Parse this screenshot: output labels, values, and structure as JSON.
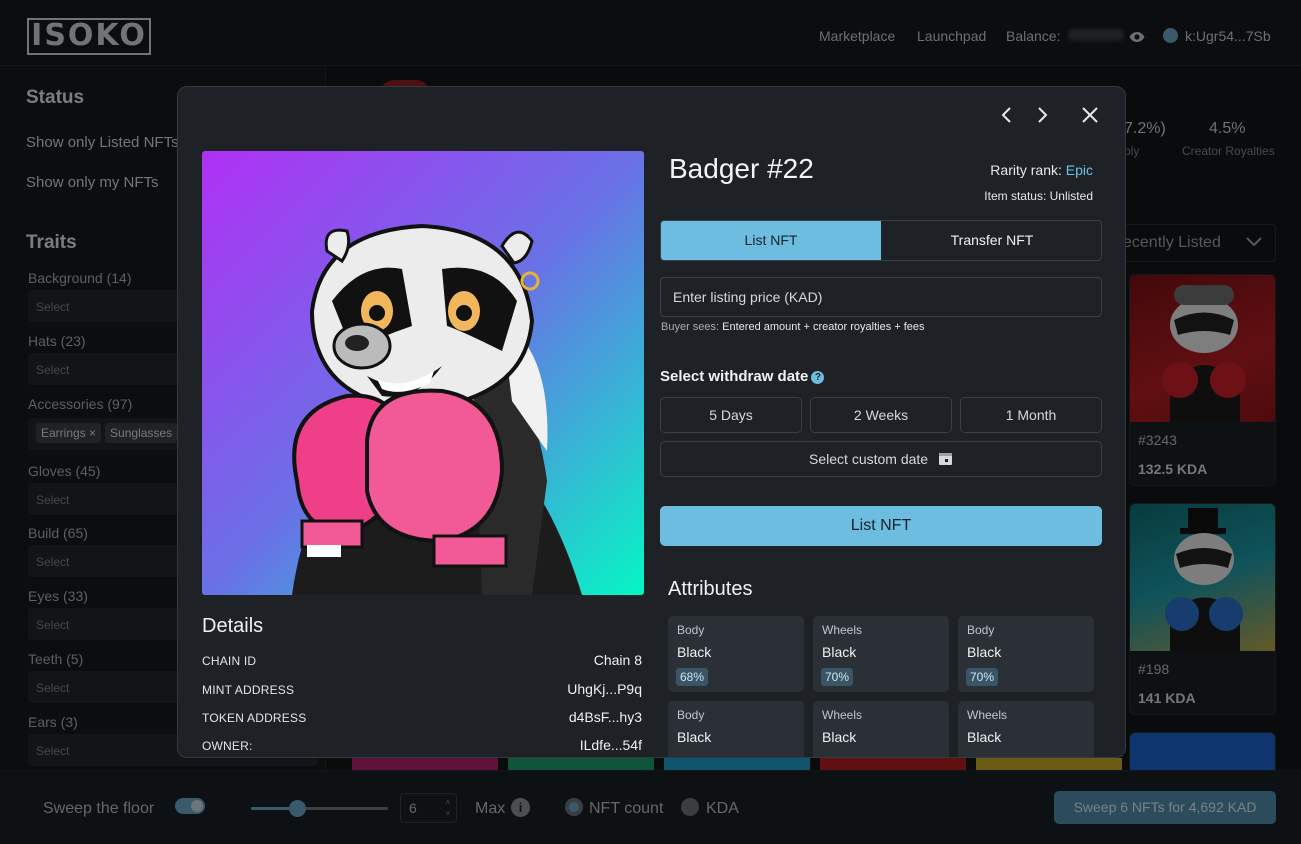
{
  "header": {
    "logo": "ISOKO",
    "nav": [
      "Marketplace",
      "Launchpad"
    ],
    "balance_label": "Balance:",
    "wallet": "k:Ugr54...7Sb"
  },
  "sidebar": {
    "status_title": "Status",
    "status_options": [
      "Show only Listed NFTs",
      "Show only my NFTs"
    ],
    "traits_title": "Traits",
    "traits": [
      {
        "label": "Background (14)",
        "placeholder": "Select"
      },
      {
        "label": "Hats (23)",
        "placeholder": "Select"
      },
      {
        "label": "Accessories (97)",
        "chips": [
          "Earrings",
          "Sunglasses"
        ]
      },
      {
        "label": "Gloves (45)",
        "placeholder": "Select"
      },
      {
        "label": "Build (65)",
        "placeholder": "Select"
      },
      {
        "label": "Eyes (33)",
        "placeholder": "Select"
      },
      {
        "label": "Teeth (5)",
        "placeholder": "Select"
      },
      {
        "label": "Ears (3)",
        "placeholder": "Select"
      }
    ]
  },
  "stats": {
    "supply_value": "7.2%)",
    "supply_label": "ply",
    "royalties_value": "4.5%",
    "royalties_label": "Creator Royalties"
  },
  "sort": {
    "label": "ecently Listed"
  },
  "cards": [
    {
      "id": "#3243",
      "price": "132.5 KDA"
    },
    {
      "id": "#198",
      "price": "141 KDA"
    }
  ],
  "bottom": {
    "sweep_label": "Sweep the floor",
    "count_value": "6",
    "max_label": "Max",
    "radio_count": "NFT count",
    "radio_kda": "KDA",
    "sweep_button": "Sweep 6 NFTs for 4,692 KAD"
  },
  "modal": {
    "title": "Badger #22",
    "rarity_label": "Rarity rank:",
    "rarity_value": "Epic",
    "status_text": "Item status: Unlisted",
    "tab_list": "List NFT",
    "tab_transfer": "Transfer NFT",
    "price_placeholder": "Enter listing price (KAD)",
    "buyer_label": "Buyer sees:",
    "buyer_text": "Entered amount + creator royalties + fees",
    "withdraw_title": "Select withdraw date",
    "date_options": [
      "5 Days",
      "2 Weeks",
      "1 Month"
    ],
    "custom_date": "Select custom date",
    "list_button": "List NFT",
    "details_title": "Details",
    "details": [
      {
        "label": "CHAIN ID",
        "value": "Chain 8"
      },
      {
        "label": "MINT ADDRESS",
        "value": "UhgKj...P9q"
      },
      {
        "label": "TOKEN ADDRESS",
        "value": "d4BsF...hy3"
      },
      {
        "label": "OWNER:",
        "value": "ILdfe...54f"
      }
    ],
    "attributes_title": "Attributes",
    "attributes": [
      {
        "type": "Body",
        "value": "Black",
        "pct": "68%"
      },
      {
        "type": "Wheels",
        "value": "Black",
        "pct": "70%"
      },
      {
        "type": "Body",
        "value": "Black",
        "pct": "70%"
      },
      {
        "type": "Body",
        "value": "Black",
        "pct": ""
      },
      {
        "type": "Wheels",
        "value": "Black",
        "pct": ""
      },
      {
        "type": "Wheels",
        "value": "Black",
        "pct": ""
      }
    ]
  },
  "colors": {
    "accent": "#6cbde0",
    "epic": "#6cc0e6",
    "modal_bg": "#1e2227"
  }
}
